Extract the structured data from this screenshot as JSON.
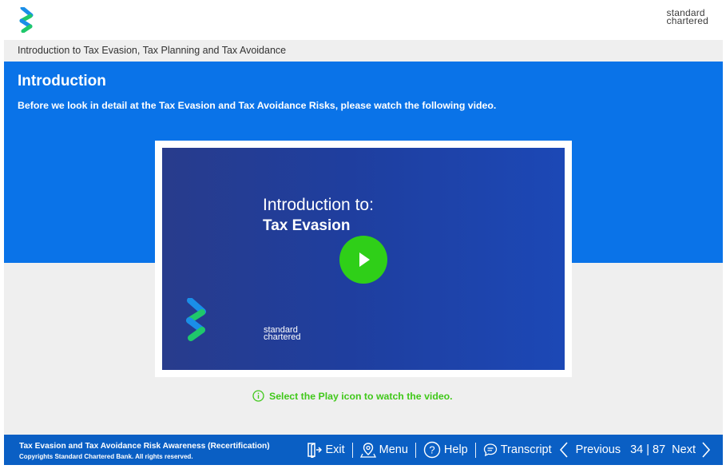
{
  "brand": {
    "line1": "standard",
    "line2": "chartered"
  },
  "breadcrumb": "Introduction to Tax Evasion, Tax Planning and Tax Avoidance",
  "intro": {
    "title": "Introduction",
    "text": "Before we look in detail at the Tax Evasion and Tax Avoidance Risks, please watch the following video."
  },
  "video": {
    "line1": "Introduction to:",
    "line2": "Tax Evasion",
    "brand_line1": "standard",
    "brand_line2": "chartered"
  },
  "hint": "Select the Play icon to watch the video.",
  "footer": {
    "course_title": "Tax Evasion and Tax Avoidance Risk Awareness (Recertification)",
    "copyright": "Copyrights Standard Chartered Bank. All rights reserved.",
    "exit": "Exit",
    "menu": "Menu",
    "help": "Help",
    "transcript": "Transcript",
    "previous": "Previous",
    "page": "34 | 87",
    "next": "Next"
  },
  "colors": {
    "blue_panel": "#0a73e8",
    "footer": "#0a5fc4",
    "accent_green": "#40c81a",
    "play_green": "#2fcf18"
  },
  "icons": [
    "sc-logo-icon",
    "play-icon",
    "info-icon",
    "exit-icon",
    "location-pin-icon",
    "help-icon",
    "speech-bubble-icon",
    "chevron-left-icon",
    "chevron-right-icon"
  ]
}
